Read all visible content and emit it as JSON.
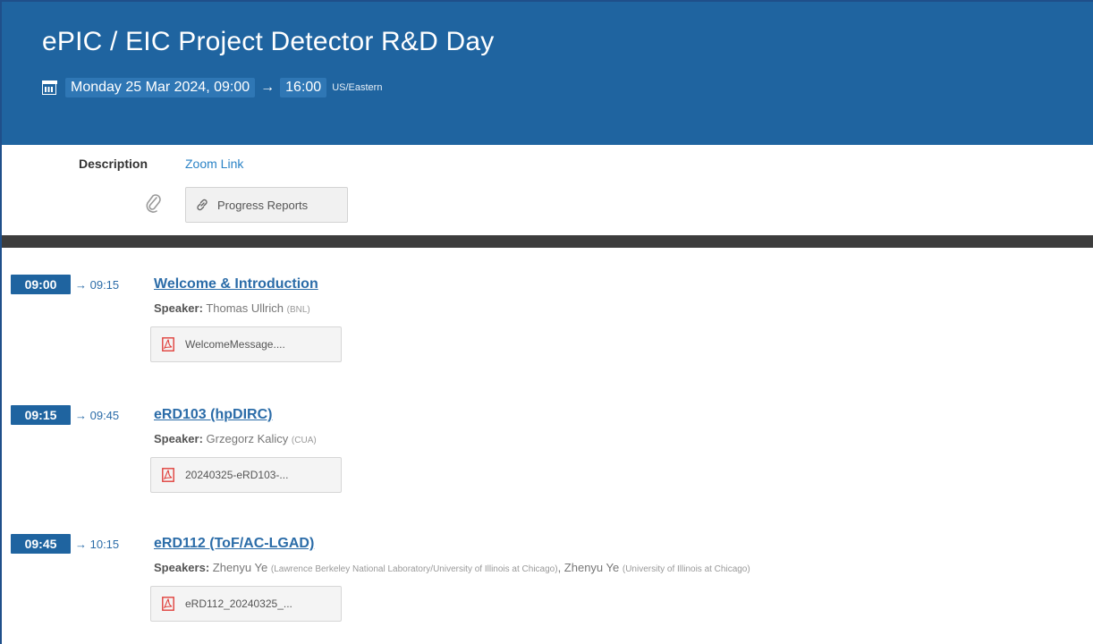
{
  "event": {
    "title": "ePIC / EIC Project Detector R&D Day",
    "date_start": "Monday 25 Mar 2024, 09:00",
    "arrow": "→",
    "time_end": "16:00",
    "timezone": "US/Eastern"
  },
  "description": {
    "label": "Description",
    "link_text": "Zoom Link",
    "attachment_label": "Progress Reports"
  },
  "entries": [
    {
      "start": "09:00",
      "end": "→ 09:15",
      "title": "Welcome & Introduction",
      "speaker_label": "Speaker:",
      "speakers": "Thomas Ullrich",
      "affiliation": "(BNL)",
      "file": "WelcomeMessage...."
    },
    {
      "start": "09:15",
      "end": "→ 09:45",
      "title": "eRD103 (hpDIRC)",
      "speaker_label": "Speaker:",
      "speakers": "Grzegorz Kalicy",
      "affiliation": "(CUA)",
      "file": "20240325-eRD103-..."
    },
    {
      "start": "09:45",
      "end": "→ 10:15",
      "title": "eRD112 (ToF/AC-LGAD)",
      "speaker_label": "Speakers:",
      "speakers": "Zhenyu Ye",
      "affiliation": "(Lawrence Berkeley National Laboratory/University of Illinois at Chicago)",
      "speakers2": "Zhenyu Ye",
      "affiliation2": "(University of Illinois at Chicago)",
      "file": "eRD112_20240325_..."
    }
  ],
  "colors": {
    "header_bg": "#1f64a0",
    "accent_link": "#2b83c6",
    "title_blue": "#2b6ca8",
    "dark_bar": "#3d3d3d",
    "pdf_red": "#e0403c"
  },
  "icons": [
    "calendar-icon",
    "paperclip-icon",
    "link-icon",
    "pdf-icon"
  ]
}
